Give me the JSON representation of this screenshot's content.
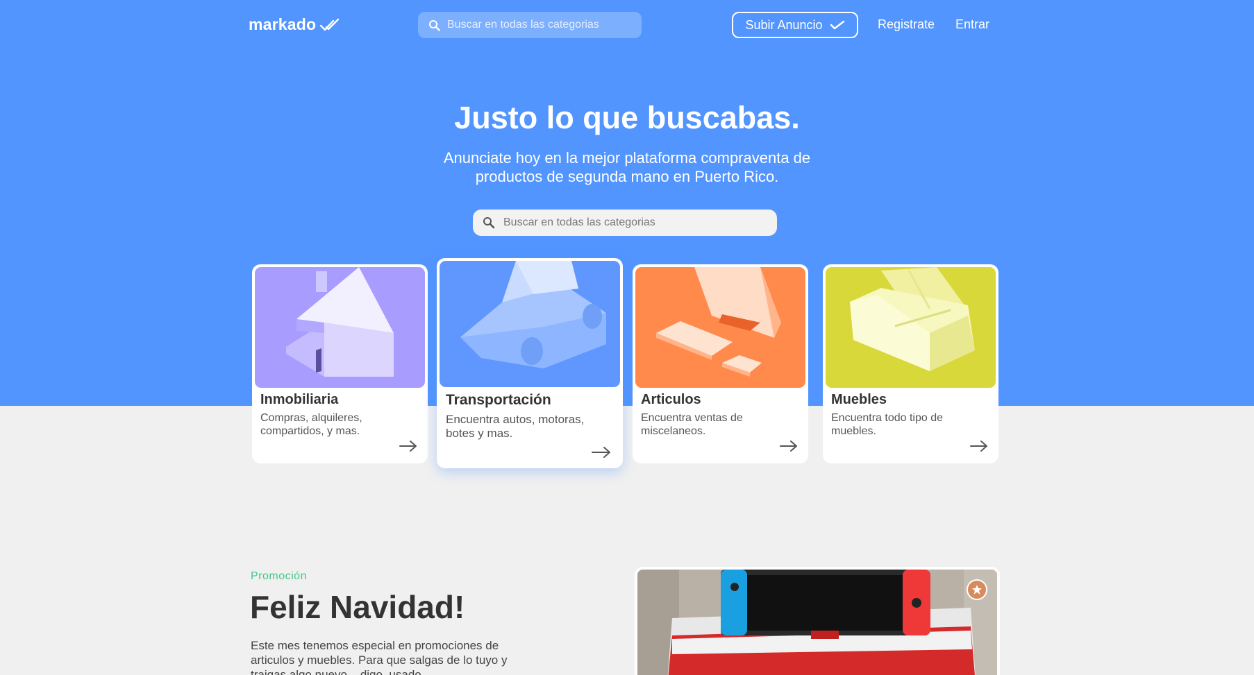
{
  "nav": {
    "logo_text": "markado",
    "search_placeholder": "Buscar en todas las categorias",
    "post_ad_label": "Subir Anuncio",
    "register_label": "Registrate",
    "login_label": "Entrar"
  },
  "hero": {
    "title": "Justo lo que buscabas.",
    "subtitle": "Anunciate hoy en la mejor plataforma compraventa de productos de segunda mano en Puerto Rico.",
    "search_placeholder": "Buscar en todas las categorias"
  },
  "categories": [
    {
      "title": "Inmobiliaria",
      "description": "Compras, alquileres, compartidos, y mas.",
      "icon": "house-icon",
      "color": "#a99cff"
    },
    {
      "title": "Transportación",
      "description": "Encuentra autos, motoras, botes y mas.",
      "icon": "car-icon",
      "color": "#5f97ff"
    },
    {
      "title": "Articulos",
      "description": "Encuentra ventas de miscelaneos.",
      "icon": "items-icon",
      "color": "#ff8a4c"
    },
    {
      "title": "Muebles",
      "description": "Encuentra todo tipo de muebles.",
      "icon": "sofa-icon",
      "color": "#d8d83a"
    }
  ],
  "promo": {
    "label": "Promoción",
    "title": "Feliz Navidad!",
    "text": "Este mes tenemos especial en promociones de articulos y muebles. Para que salgas de lo tuyo y traigas algo nuevo... digo, usado."
  },
  "colors": {
    "brand_blue": "#5295ff",
    "promo_green": "#3ec986",
    "favorite_badge": "#d98a5c"
  }
}
